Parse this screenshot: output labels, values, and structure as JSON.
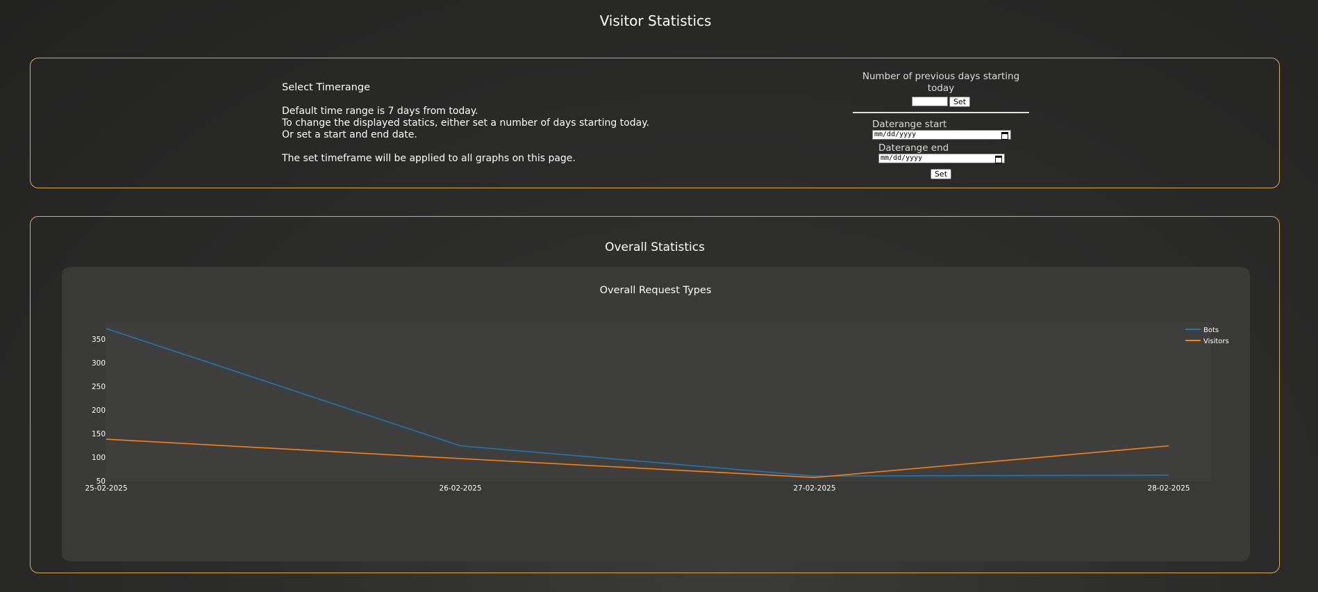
{
  "page": {
    "title": "Visitor Statistics"
  },
  "timerange": {
    "heading": "Select Timerange",
    "lines": [
      "Default time range is 7 days from today.",
      "To change the displayed statics, either set a number of days starting today.",
      "Or set a start and end date."
    ],
    "note": "The set timeframe will be applied to all graphs on this page."
  },
  "form": {
    "days_label": "Number of previous days starting today",
    "days_value": "",
    "set_label": "Set",
    "start_label": "Daterange start",
    "start_placeholder": "mm/dd/yyyy",
    "end_label": "Daterange end",
    "end_placeholder": "mm/dd/yyyy",
    "set_range_label": "Set"
  },
  "overall": {
    "title": "Overall Statistics"
  },
  "chart_data": {
    "type": "line",
    "title": "Overall Request Types",
    "categories": [
      "25-02-2025",
      "26-02-2025",
      "27-02-2025",
      "28-02-2025"
    ],
    "series": [
      {
        "name": "Bots",
        "values": [
          372,
          124,
          60,
          62
        ],
        "color": "#1f77b4"
      },
      {
        "name": "Visitors",
        "values": [
          138,
          97,
          57,
          124
        ],
        "color": "#ff7f0e"
      }
    ],
    "y_ticks": [
      50,
      100,
      150,
      200,
      250,
      300,
      350
    ],
    "ylim": [
      50,
      385
    ],
    "grid": false,
    "legend": "top-right"
  }
}
